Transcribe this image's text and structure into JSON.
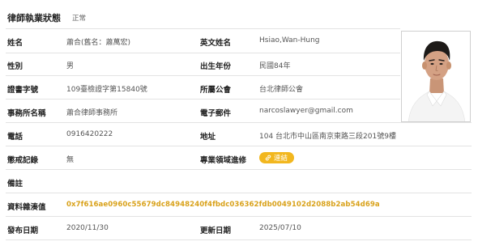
{
  "status": {
    "label": "律師執業狀態",
    "value": "正常"
  },
  "fields": {
    "name_label": "姓名",
    "name_value": "蕭合(舊名：蕭萬宏)",
    "english_name_label": "英文姓名",
    "english_name_value": "Hsiao,Wan-Hung",
    "gender_label": "性別",
    "gender_value": "男",
    "birth_year_label": "出生年份",
    "birth_year_value": "民國84年",
    "license_label": "證書字號",
    "license_value": "109臺檢證字第15840號",
    "bar_label": "所屬公會",
    "bar_value": "台北律師公會",
    "firm_label": "事務所名稱",
    "firm_value": "蕭合律師事務所",
    "email_label": "電子郵件",
    "email_value": "narcoslawyer@gmail.com",
    "phone_label": "電話",
    "phone_value": "0916420222",
    "address_label": "地址",
    "address_value": "104 台北市中山區南京東路三段201號9樓",
    "discipline_label": "懲戒記錄",
    "discipline_value": "無",
    "specialty_label": "專業領域進修",
    "specialty_link": "連結",
    "remarks_label": "備註",
    "hash_label": "資料雜湊值",
    "hash_value": "0x7f616ae0960c55679dc84948240f4fbdc036362fdb0049102d2088b2ab54d69a",
    "published_label": "發布日期",
    "published_value": "2020/11/30",
    "updated_label": "更新日期",
    "updated_value": "2025/07/10"
  },
  "icons": {
    "link": "link-icon",
    "photo": "profile-photo"
  },
  "colors": {
    "accent": "#f2b71f",
    "hash": "#d9a21b",
    "label": "#222222",
    "value": "#555555",
    "divider": "#e3e3e3"
  }
}
